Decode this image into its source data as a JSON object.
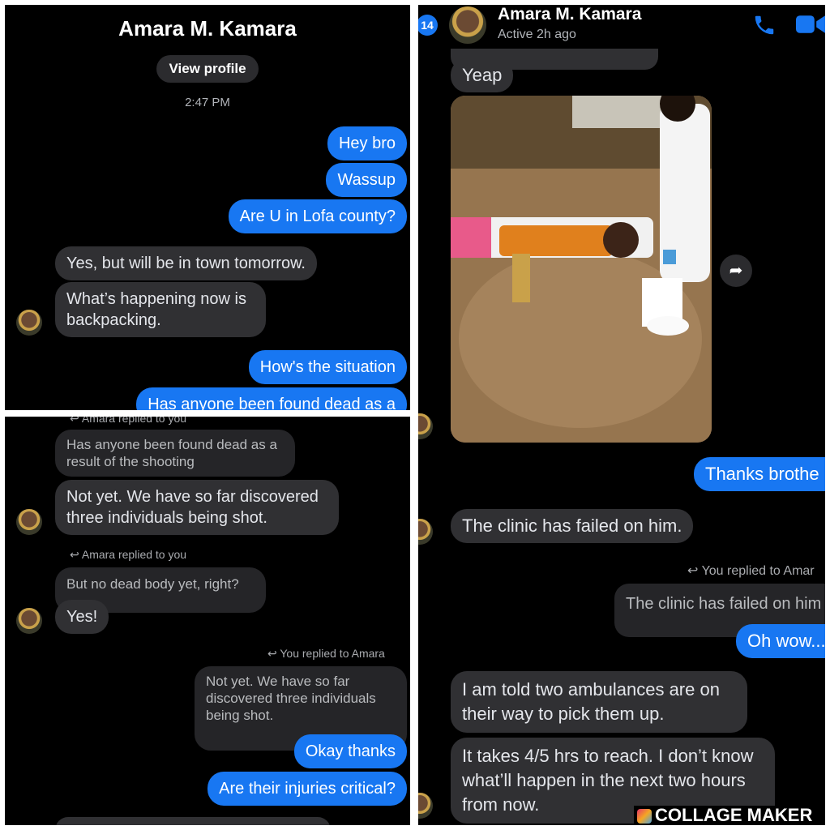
{
  "panel1": {
    "contact_name": "Amara M. Kamara",
    "view_profile_label": "View profile",
    "timestamp": "2:47 PM",
    "messages": [
      {
        "text": "Hey bro"
      },
      {
        "text": "Wassup"
      },
      {
        "text": "Are U in Lofa county?"
      },
      {
        "text": "Yes, but will be in town tomorrow."
      },
      {
        "text": "What’s happening now is backpacking."
      },
      {
        "text": "How's the situation"
      },
      {
        "text": "Has anyone been found dead as a"
      }
    ]
  },
  "panel2": {
    "unread_count": "14",
    "contact_name": "Amara M. Kamara",
    "status": "Active 2h ago",
    "messages": [
      {
        "text": "Yeap"
      },
      {
        "text": "Thanks brothe"
      },
      {
        "text": "The clinic has failed on him."
      },
      {
        "text": "You replied to Amar"
      },
      {
        "text": "The clinic has failed on him"
      },
      {
        "text": "Oh wow..."
      },
      {
        "text": "I am told two ambulances are on their way to pick them up."
      },
      {
        "text": "It takes 4/5 hrs to reach. I don’t know what’ll happen in the next two hours from now."
      }
    ],
    "photo_description_icon": "stretcher-photo"
  },
  "panel3": {
    "top_cut_note": "Amara replied to you",
    "messages": [
      {
        "text": "Has anyone been found dead as a result of the shooting"
      },
      {
        "text": "Not yet. We have so far discovered three individuals being shot."
      },
      {
        "text": "Amara replied to you"
      },
      {
        "text": "But no dead body yet, right?"
      },
      {
        "text": "Yes!"
      },
      {
        "text": "You replied to Amara"
      },
      {
        "text": "Not yet. We have so far discovered three individuals being shot."
      },
      {
        "text": "Okay thanks"
      },
      {
        "text": "Are their injuries critical?"
      }
    ]
  },
  "watermark": "COLLAGE MAKER",
  "colors": {
    "accent": "#1877f2",
    "bubble_them": "#303033",
    "background": "#000000"
  }
}
